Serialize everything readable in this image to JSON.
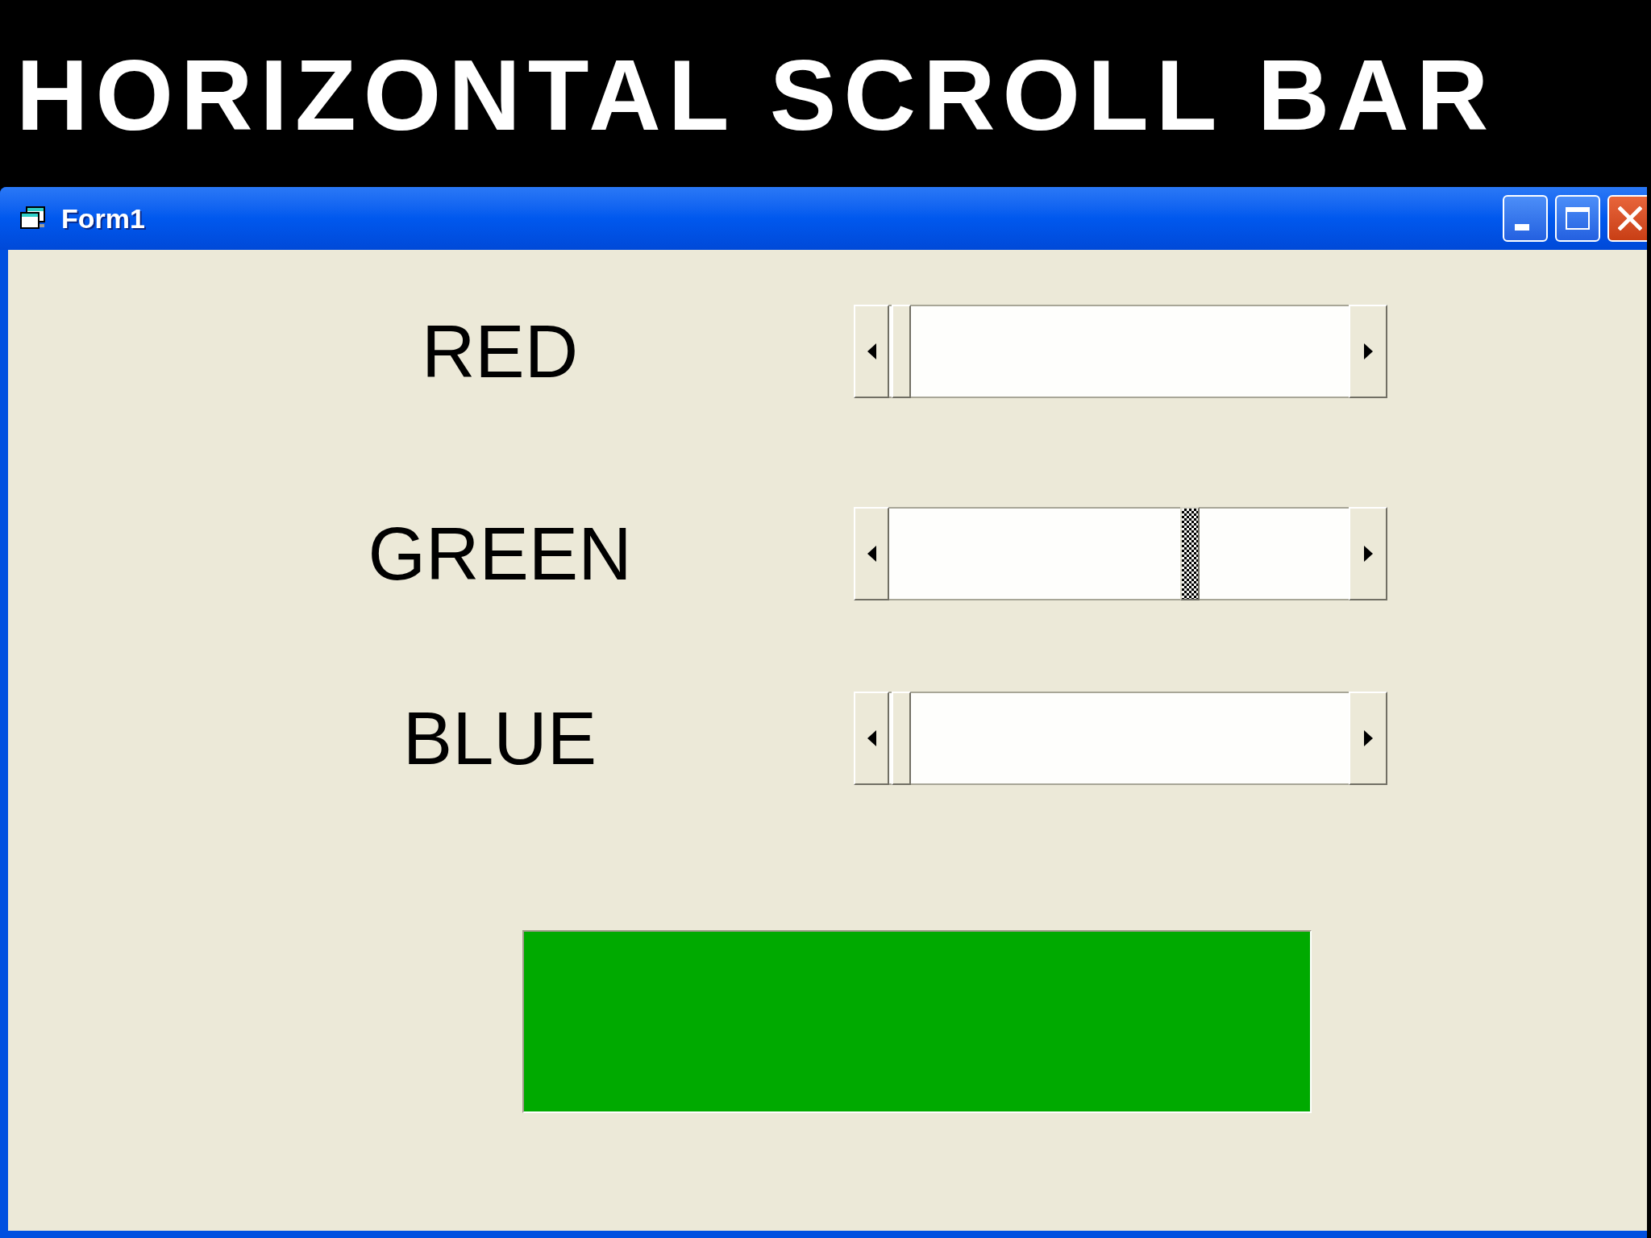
{
  "heading": "HORIZONTAL SCROLL BAR",
  "window": {
    "title": "Form1"
  },
  "scrollbars": [
    {
      "label": "RED",
      "level": 0,
      "focused": false
    },
    {
      "label": "GREEN",
      "level": 0.667,
      "focused": true
    },
    {
      "label": "BLUE",
      "level": 0,
      "focused": false
    }
  ]
}
